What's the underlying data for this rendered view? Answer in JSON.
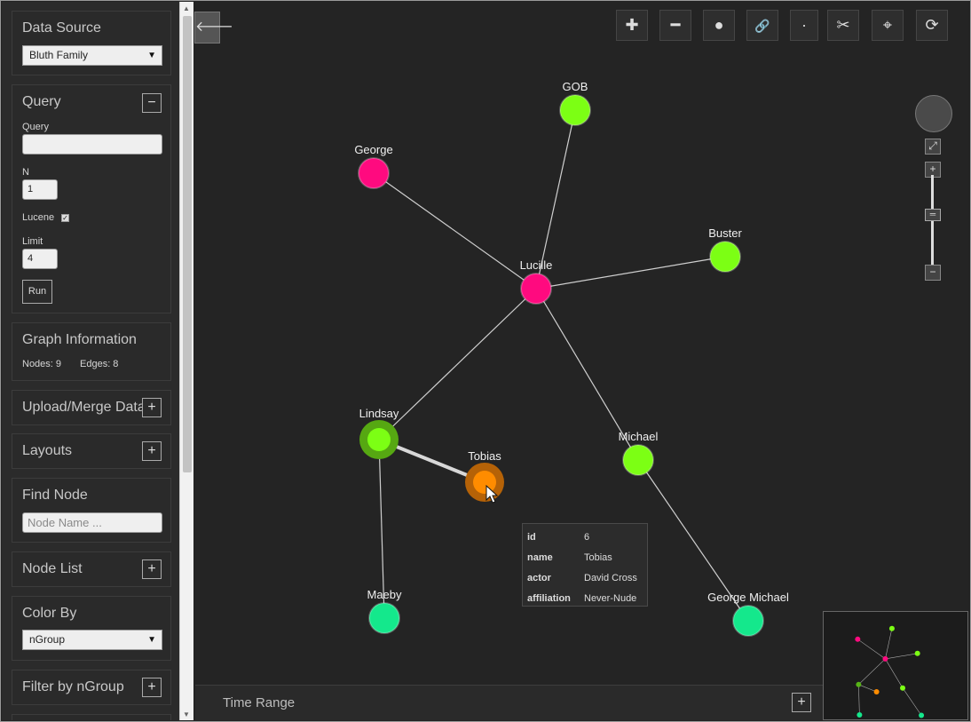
{
  "colors": {
    "background": "#242424",
    "sidebar": "#2b2b2b",
    "pink": "#ff0a7f",
    "lime": "#7cff14",
    "green": "#57b316",
    "orange": "#ff8c00",
    "teal": "#14e88c",
    "edge": "#cfcfcf"
  },
  "sidebar": {
    "data_source": {
      "title": "Data Source",
      "selected": "Bluth Family"
    },
    "query": {
      "title": "Query",
      "query_label": "Query",
      "query_value": "",
      "n_label": "N",
      "n_value": "1",
      "lucene_label": "Lucene",
      "limit_label": "Limit",
      "limit_value": "4",
      "run_label": "Run"
    },
    "graph_info": {
      "title": "Graph Information",
      "nodes": "Nodes: 9",
      "edges": "Edges: 8"
    },
    "upload": {
      "title": "Upload/Merge Data"
    },
    "layouts": {
      "title": "Layouts"
    },
    "find_node": {
      "title": "Find Node",
      "placeholder": "Node Name ..."
    },
    "node_list": {
      "title": "Node List"
    },
    "color_by": {
      "title": "Color By",
      "selected": "nGroup"
    },
    "filter": {
      "title": "Filter by nGroup"
    }
  },
  "toolbar": [
    {
      "name": "add-icon",
      "glyph": "✚"
    },
    {
      "name": "remove-icon",
      "glyph": "━"
    },
    {
      "name": "circle-icon",
      "glyph": "●"
    },
    {
      "name": "link-icon",
      "glyph": "🔗"
    },
    {
      "name": "dot-icon",
      "glyph": "·"
    },
    {
      "name": "unlink-icon",
      "glyph": "✂"
    },
    {
      "name": "crosshair-icon",
      "glyph": "⌖"
    },
    {
      "name": "refresh-icon",
      "glyph": "⟳"
    }
  ],
  "graph": {
    "nodes": [
      {
        "id": "george",
        "label": "George",
        "color": "pink"
      },
      {
        "id": "gob",
        "label": "GOB",
        "color": "lime"
      },
      {
        "id": "buster",
        "label": "Buster",
        "color": "lime"
      },
      {
        "id": "lucille",
        "label": "Lucille",
        "color": "pink"
      },
      {
        "id": "lindsay",
        "label": "Lindsay",
        "color": "green"
      },
      {
        "id": "tobias",
        "label": "Tobias",
        "color": "orange"
      },
      {
        "id": "michael",
        "label": "Michael",
        "color": "lime"
      },
      {
        "id": "maeby",
        "label": "Maeby",
        "color": "teal"
      },
      {
        "id": "george-michael",
        "label": "George Michael",
        "color": "teal"
      }
    ],
    "edges": [
      [
        "george",
        "lucille"
      ],
      [
        "gob",
        "lucille"
      ],
      [
        "buster",
        "lucille"
      ],
      [
        "lucille",
        "lindsay"
      ],
      [
        "lucille",
        "michael"
      ],
      [
        "lindsay",
        "tobias"
      ],
      [
        "lindsay",
        "maeby"
      ],
      [
        "michael",
        "george-michael"
      ]
    ]
  },
  "tooltip": {
    "rows": [
      {
        "key": "id",
        "value": "6"
      },
      {
        "key": "name",
        "value": "Tobias"
      },
      {
        "key": "actor",
        "value": "David Cross"
      },
      {
        "key": "affiliation",
        "value": "Never-Nude"
      }
    ]
  },
  "time_range": {
    "title": "Time Range"
  }
}
